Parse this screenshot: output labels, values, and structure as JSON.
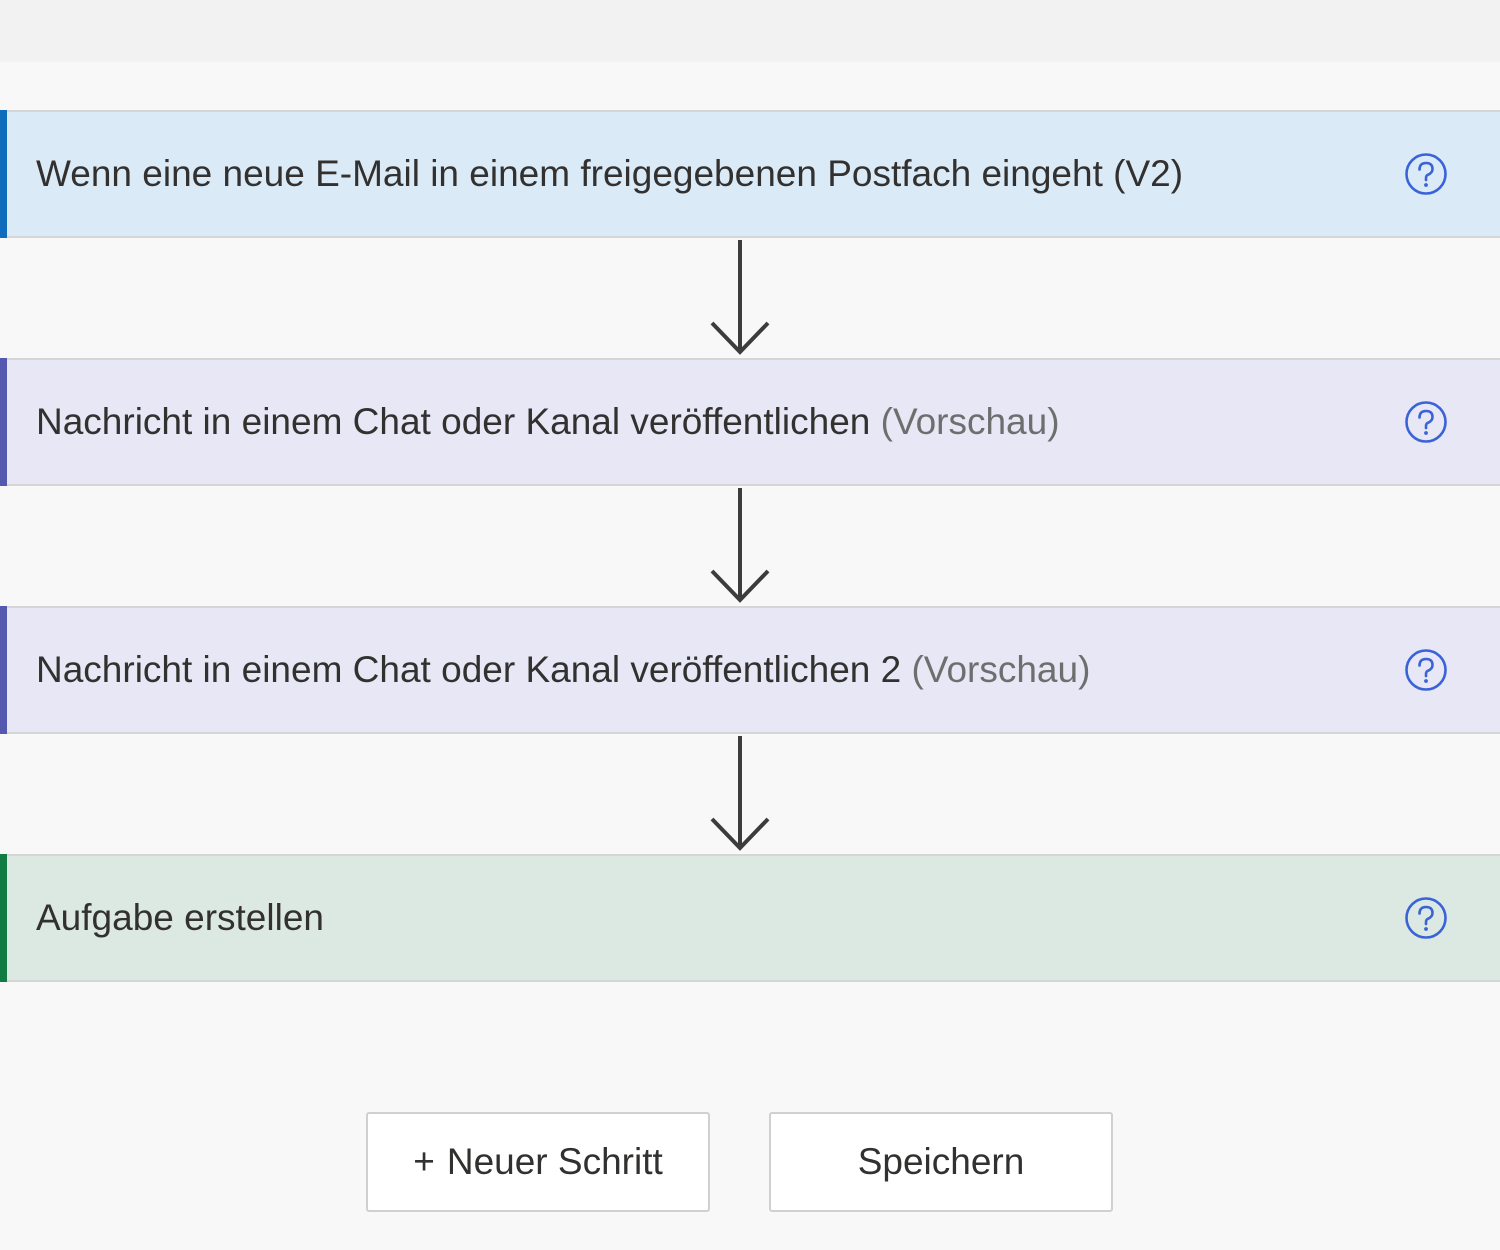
{
  "steps": [
    {
      "title": "Wenn eine neue E-Mail in einem freigegebenen Postfach eingeht (V2)",
      "subtitle": "",
      "bg": "#dbeaf7",
      "accent": "#0f6cbd"
    },
    {
      "title": "Nachricht in einem Chat oder Kanal veröffentlichen",
      "subtitle": "(Vorschau)",
      "bg": "#e7e7f5",
      "accent": "#5558af"
    },
    {
      "title": "Nachricht in einem Chat oder Kanal veröffentlichen 2",
      "subtitle": "(Vorschau)",
      "bg": "#e7e7f5",
      "accent": "#5558af"
    },
    {
      "title": "Aufgabe erstellen",
      "subtitle": "",
      "bg": "#dce9e2",
      "accent": "#107c41"
    }
  ],
  "help_icon": "help-circle-icon",
  "help_icon_color": "#3a63d8",
  "connector_icon": "arrow-down-icon",
  "connector_color": "#3c3c3c",
  "buttons": {
    "new_step_plus": "+",
    "new_step_label": "Neuer Schritt",
    "save_label": "Speichern"
  }
}
